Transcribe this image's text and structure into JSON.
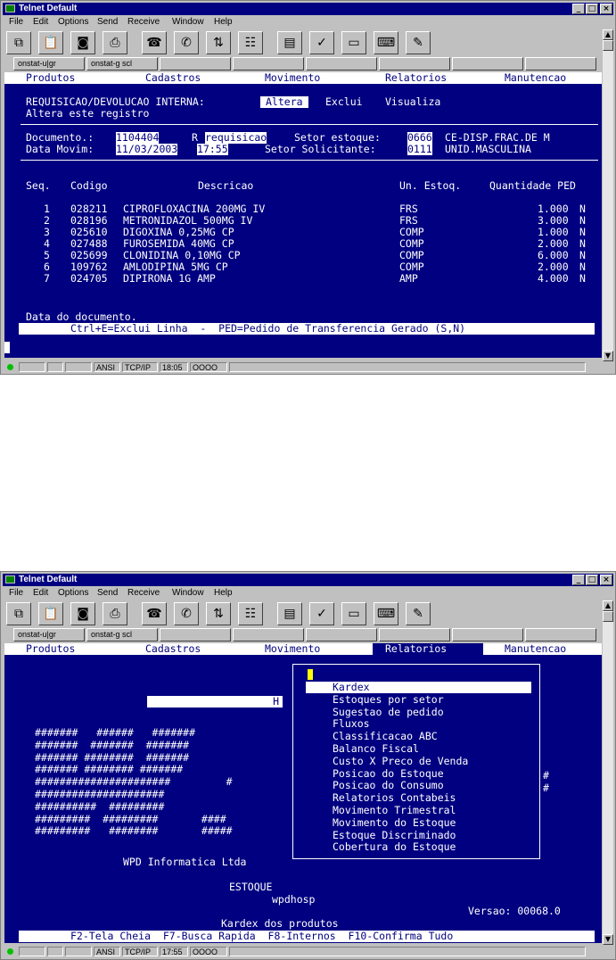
{
  "window": {
    "title": "Telnet Default",
    "menu": [
      "File",
      "Edit",
      "Options",
      "Send",
      "Receive",
      "Window",
      "Help"
    ],
    "controls": [
      "_",
      "□",
      "×"
    ],
    "session_tabs": [
      "onstat-u|gr",
      "onstat-g scl"
    ],
    "toolbar_icons": [
      "copy-icon",
      "paste-icon",
      "camera-icon",
      "printer-icon",
      "phone-icon",
      "hangup-icon",
      "transfer-icon",
      "properties-icon",
      "stamp-icon",
      "spellcheck-icon",
      "monitor-icon",
      "keyboard-icon",
      "script-icon"
    ]
  },
  "top": {
    "menubar": [
      "Produtos",
      "Cadastros",
      "Movimento",
      "Relatorios",
      "Manutencao"
    ],
    "header_label": "REQUISICAO/DEVOLUCAO INTERNA:",
    "actions": [
      "Altera",
      "Exclui",
      "Visualiza"
    ],
    "subtitle": "Altera este registro",
    "doc_label": "Documento.:",
    "doc_value": "1104404",
    "doc_type_code": "R",
    "doc_type_text": "requisicao",
    "setor_estoque_label": "Setor estoque:",
    "setor_estoque_code": "0666",
    "setor_estoque_name": "CE-DISP.FRAC.DE M",
    "data_label": "Data Movim:",
    "data_value": "11/03/2003",
    "time_value": "17:55",
    "setor_solic_label": "Setor Solicitante:",
    "setor_solic_code": "0111",
    "setor_solic_name": "UNID.MASCULINA",
    "columns": [
      "Seq.",
      "Codigo",
      "Descricao",
      "Un. Estoq.",
      "Quantidade PED"
    ],
    "rows": [
      {
        "seq": "1",
        "codigo": "028211",
        "descricao": "CIPROFLOXACINA 200MG IV",
        "un": "FRS",
        "qtd": "1.000",
        "ped": "N"
      },
      {
        "seq": "2",
        "codigo": "028196",
        "descricao": "METRONIDAZOL 500MG IV",
        "un": "FRS",
        "qtd": "3.000",
        "ped": "N"
      },
      {
        "seq": "3",
        "codigo": "025610",
        "descricao": "DIGOXINA 0,25MG CP",
        "un": "COMP",
        "qtd": "1.000",
        "ped": "N"
      },
      {
        "seq": "4",
        "codigo": "027488",
        "descricao": "FUROSEMIDA 40MG CP",
        "un": "COMP",
        "qtd": "2.000",
        "ped": "N"
      },
      {
        "seq": "5",
        "codigo": "025699",
        "descricao": "CLONIDINA 0,10MG CP",
        "un": "COMP",
        "qtd": "6.000",
        "ped": "N"
      },
      {
        "seq": "6",
        "codigo": "109762",
        "descricao": "AMLODIPINA 5MG CP",
        "un": "COMP",
        "qtd": "2.000",
        "ped": "N"
      },
      {
        "seq": "7",
        "codigo": "024705",
        "descricao": "DIPIRONA 1G AMP",
        "un": "AMP",
        "qtd": "4.000",
        "ped": "N"
      }
    ],
    "footer_hint": "Data do documento.",
    "footer_bar": "Ctrl+E=Exclui Linha  -  PED=Pedido de Transferencia Gerado (S,N)",
    "status": {
      "mode": "ANSI",
      "proto": "TCP/IP",
      "time": "18:05",
      "keys": "OOOO"
    }
  },
  "bottom": {
    "menubar": [
      "Produtos",
      "Cadastros",
      "Movimento",
      "Relatorios",
      "Manutencao"
    ],
    "field_value": "H",
    "relatorios_items": [
      "Kardex",
      "Estoques por setor",
      "Sugestao de pedido",
      "Fluxos",
      "Classificacao ABC",
      "Balanco Fiscal",
      "Custo X Preco de Venda",
      "Posicao do Estoque",
      "Posicao do Consumo",
      "Relatorios Contabeis",
      "Movimento Trimestral",
      "Movimento do Estoque",
      "Estoque Discriminado",
      "Cobertura do Estoque"
    ],
    "logo_rows": [
      "#######   ######   #######",
      "#######  #######  #######",
      "####### ########  #######",
      "####### ######## #######",
      "######################         #",
      "#####################",
      "##########  #########",
      "#########  #########       ####",
      "#########   ########       #####"
    ],
    "right_hash_1": "#",
    "right_hash_2": "#",
    "company": "WPD Informatica Ltda",
    "module": "ESTOQUE",
    "host": "wpdhosp",
    "version": "Versao: 00068.0",
    "bottom_hint": "Kardex dos produtos",
    "function_keys": "F2-Tela Cheia  F7-Busca Rapida  F8-Internos  F10-Confirma Tudo",
    "status": {
      "mode": "ANSI",
      "proto": "TCP/IP",
      "time": "17:55",
      "keys": "OOOO"
    }
  }
}
